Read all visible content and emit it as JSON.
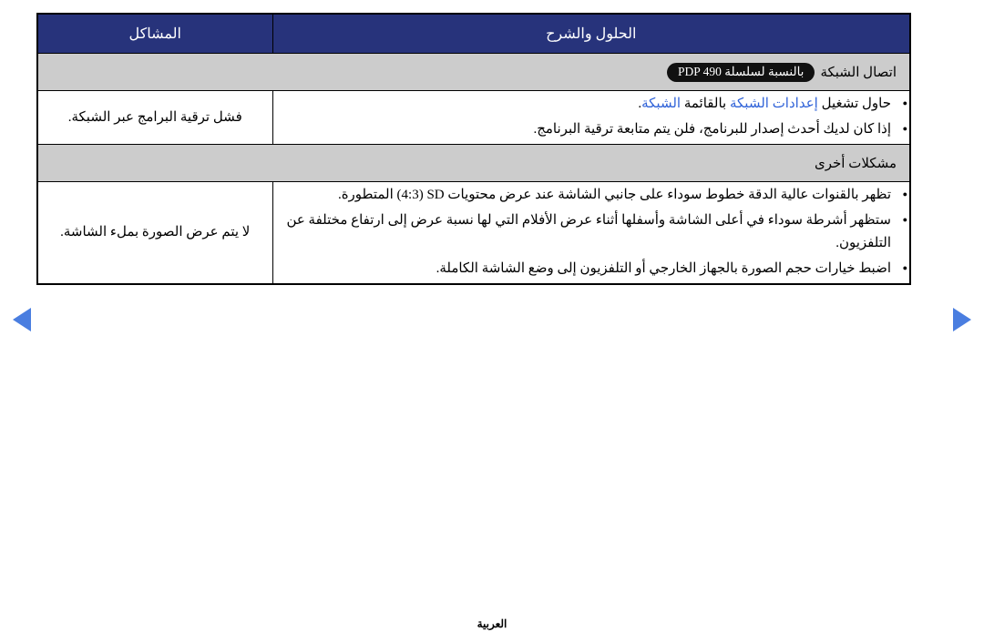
{
  "nav": {
    "prev_label": "◀",
    "next_label": "▶",
    "arrow_color": "#4a7ee0"
  },
  "table": {
    "header": {
      "solutions": "الحلول والشرح",
      "problems": "المشاكل",
      "background": "#27337b",
      "text_color": "#ffffff"
    },
    "sections": [
      {
        "title_prefix": "اتصال الشبكة",
        "badge": "بالنسبة لسلسلة",
        "badge_model": "PDP 490",
        "background": "#cccccc",
        "rows": [
          {
            "problem": "فشل ترقية البرامج عبر الشبكة.",
            "bullets": [
              {
                "parts": [
                  {
                    "text": "حاول تشغيل ",
                    "style": "normal"
                  },
                  {
                    "text": "إعدادات الشبكة",
                    "style": "blue"
                  },
                  {
                    "text": " بالقائمة ",
                    "style": "normal"
                  },
                  {
                    "text": "الشبكة",
                    "style": "blue"
                  },
                  {
                    "text": ".",
                    "style": "normal"
                  }
                ]
              },
              {
                "parts": [
                  {
                    "text": "إذا كان لديك أحدث إصدار للبرنامج، فلن يتم متابعة ترقية البرنامج.",
                    "style": "normal"
                  }
                ]
              }
            ]
          }
        ]
      },
      {
        "title_prefix": "مشكلات أخرى",
        "badge": "",
        "badge_model": "",
        "background": "#cccccc",
        "rows": [
          {
            "problem": "لا يتم عرض الصورة بملء الشاشة.",
            "bullets": [
              {
                "parts": [
                  {
                    "text": "تظهر بالقنوات عالية الدقة خطوط سوداء على جانبي الشاشة عند عرض محتويات ",
                    "style": "normal"
                  },
                  {
                    "text": "(4:3) SD",
                    "style": "ltr"
                  },
                  {
                    "text": " المتطورة.",
                    "style": "normal"
                  }
                ]
              },
              {
                "parts": [
                  {
                    "text": "ستظهر أشرطة سوداء في أعلى الشاشة وأسفلها أثناء عرض الأفلام التي لها نسبة عرض إلى ارتفاع مختلفة عن التلفزيون.",
                    "style": "normal"
                  }
                ]
              },
              {
                "parts": [
                  {
                    "text": "اضبط خيارات حجم الصورة بالجهاز الخارجي أو التلفزيون إلى وضع الشاشة الكاملة.",
                    "style": "normal"
                  }
                ]
              }
            ]
          }
        ]
      }
    ]
  },
  "footer": {
    "language": "العربية"
  }
}
